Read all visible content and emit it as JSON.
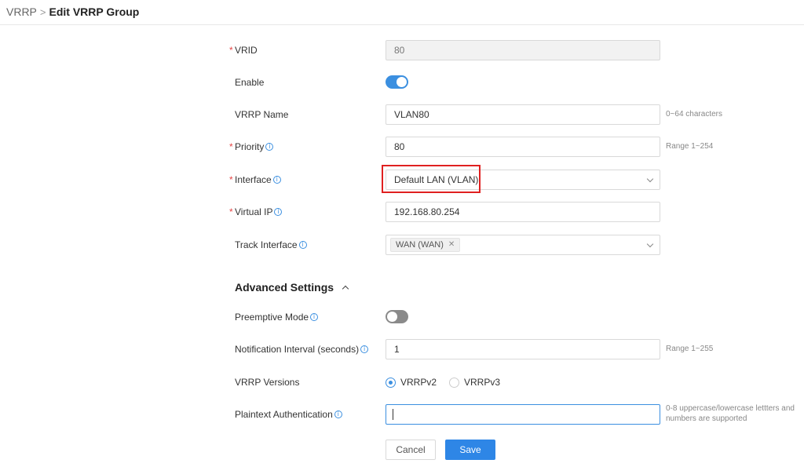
{
  "breadcrumb": {
    "parent": "VRRP",
    "separator": ">",
    "current": "Edit VRRP Group"
  },
  "form": {
    "vrid": {
      "label": "VRID",
      "required": "*",
      "value": "80"
    },
    "enable": {
      "label": "Enable",
      "on": true
    },
    "vrrp_name": {
      "label": "VRRP Name",
      "value": "VLAN80",
      "hint": "0~64 characters"
    },
    "priority": {
      "label": "Priority",
      "required": "*",
      "value": "80",
      "hint": "Range 1~254"
    },
    "interface": {
      "label": "Interface",
      "required": "*",
      "value": "Default LAN (VLAN)"
    },
    "virtual_ip": {
      "label": "Virtual IP",
      "required": "*",
      "value": "192.168.80.254"
    },
    "track_interface": {
      "label": "Track Interface",
      "tags": [
        "WAN (WAN)"
      ],
      "tag_remove": "✕"
    }
  },
  "advanced": {
    "title": "Advanced Settings",
    "preemptive_mode": {
      "label": "Preemptive Mode",
      "on": false
    },
    "notification_interval": {
      "label": "Notification Interval (seconds)",
      "value": "1",
      "hint": "Range 1~255"
    },
    "vrrp_versions": {
      "label": "VRRP Versions",
      "options": [
        "VRRPv2",
        "VRRPv3"
      ],
      "selected": "VRRPv2"
    },
    "plaintext_auth": {
      "label": "Plaintext Authentication",
      "value": "",
      "hint_line1": "0-8 uppercase/lowercase lettters and",
      "hint_line2": "numbers are supported"
    }
  },
  "buttons": {
    "cancel": "Cancel",
    "save": "Save"
  },
  "icons": {
    "info": "info-icon",
    "dropdown": "chevron-down-icon",
    "collapse": "chevron-up-icon",
    "remove": "close-icon"
  },
  "colors": {
    "accent": "#3b8fe0",
    "required": "#e54545",
    "highlight": "#e02020",
    "save_button": "#2e86e6"
  }
}
